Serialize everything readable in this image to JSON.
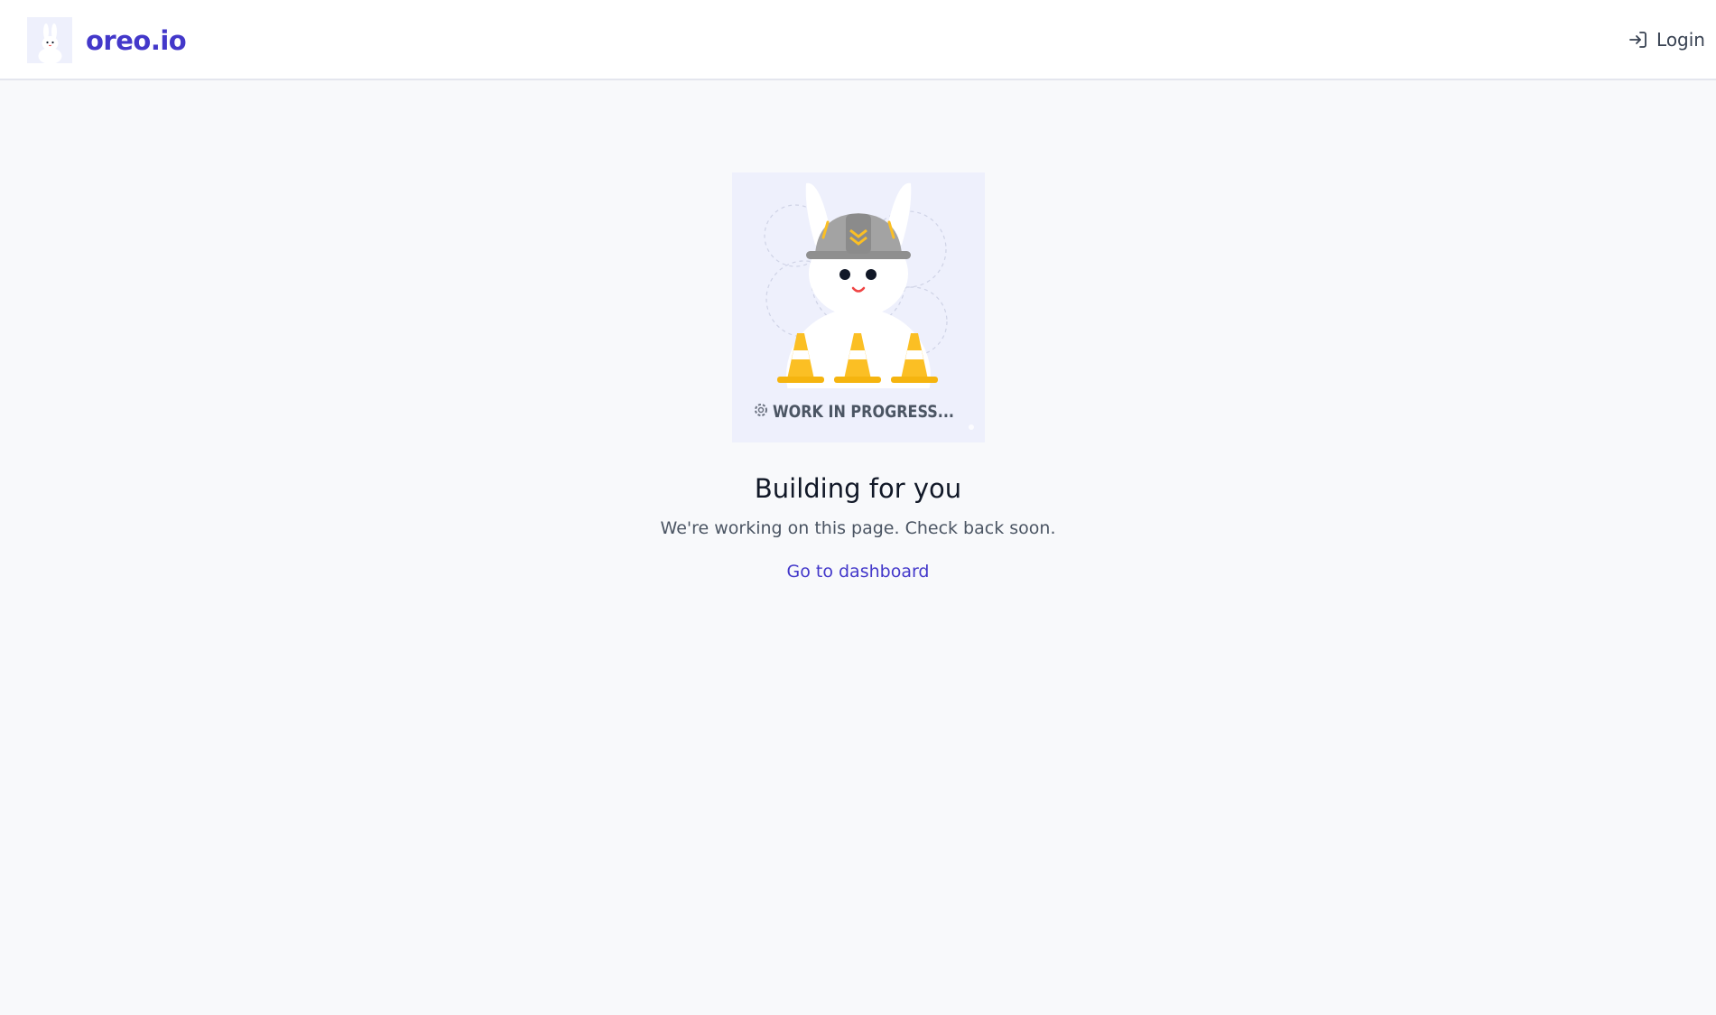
{
  "header": {
    "brand_name": "oreo.io",
    "login_label": "Login"
  },
  "illustration": {
    "caption": "WORK IN PROGRESS..."
  },
  "main": {
    "title": "Building for you",
    "subtitle": "We're working on this page. Check back soon.",
    "dashboard_link_label": "Go to dashboard"
  },
  "colors": {
    "brand": "#4338ca",
    "background": "#f8f9fb",
    "cone": "#fbbf24",
    "helmet": "#9ca3af"
  },
  "icons": {
    "logo": "bunny-logo-icon",
    "login": "login-arrow-icon"
  }
}
